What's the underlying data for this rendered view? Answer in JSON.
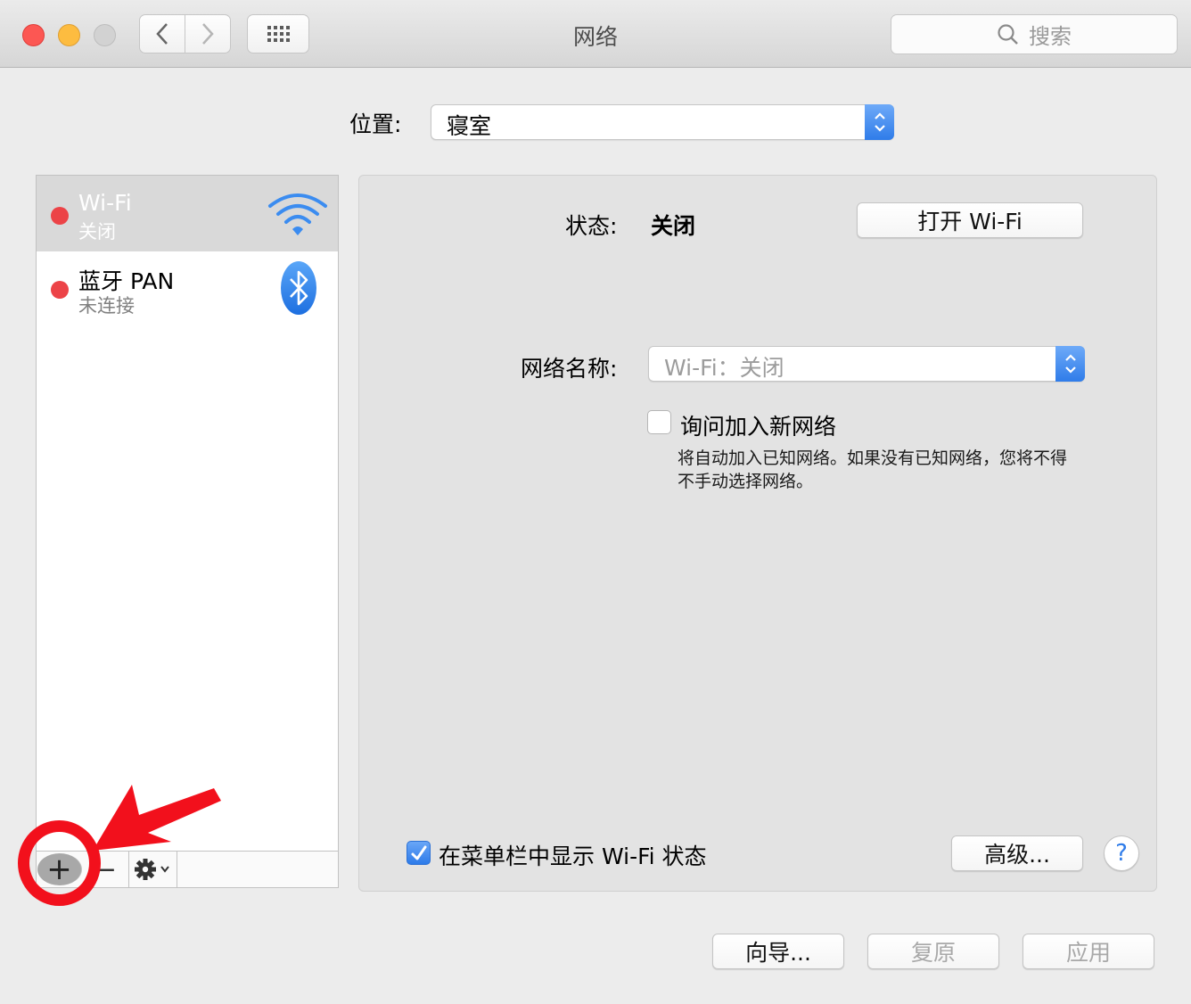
{
  "window": {
    "title": "网络",
    "search_placeholder": "搜索"
  },
  "location": {
    "label": "位置:",
    "value": "寝室"
  },
  "services": [
    {
      "name": "Wi-Fi",
      "status": "关闭",
      "selected": true,
      "icon": "wifi-icon",
      "status_color": "#ec4347"
    },
    {
      "name": "蓝牙 PAN",
      "status": "未连接",
      "selected": false,
      "icon": "bluetooth-icon",
      "status_color": "#ec4347"
    }
  ],
  "list_toolbar": {
    "add_label": "+",
    "remove_label": "−",
    "action_icon": "gear-icon"
  },
  "detail": {
    "status_label": "状态:",
    "status_value": "关闭",
    "toggle_wifi_button": "打开 Wi-Fi",
    "network_name_label": "网络名称:",
    "network_name_value": "Wi-Fi：关闭",
    "ask_join_label": "询问加入新网络",
    "ask_join_checked": false,
    "ask_join_help": "将自动加入已知网络。如果没有已知网络，您将不得不手动选择网络。",
    "show_in_menubar_label": "在菜单栏中显示 Wi-Fi 状态",
    "show_in_menubar_checked": true,
    "advanced_button": "高级...",
    "help_label": "?"
  },
  "footer": {
    "assist_button": "向导...",
    "revert_button": "复原",
    "apply_button": "应用"
  },
  "colors": {
    "accent": "#2f7ce9",
    "annotation": "#f2101c"
  }
}
